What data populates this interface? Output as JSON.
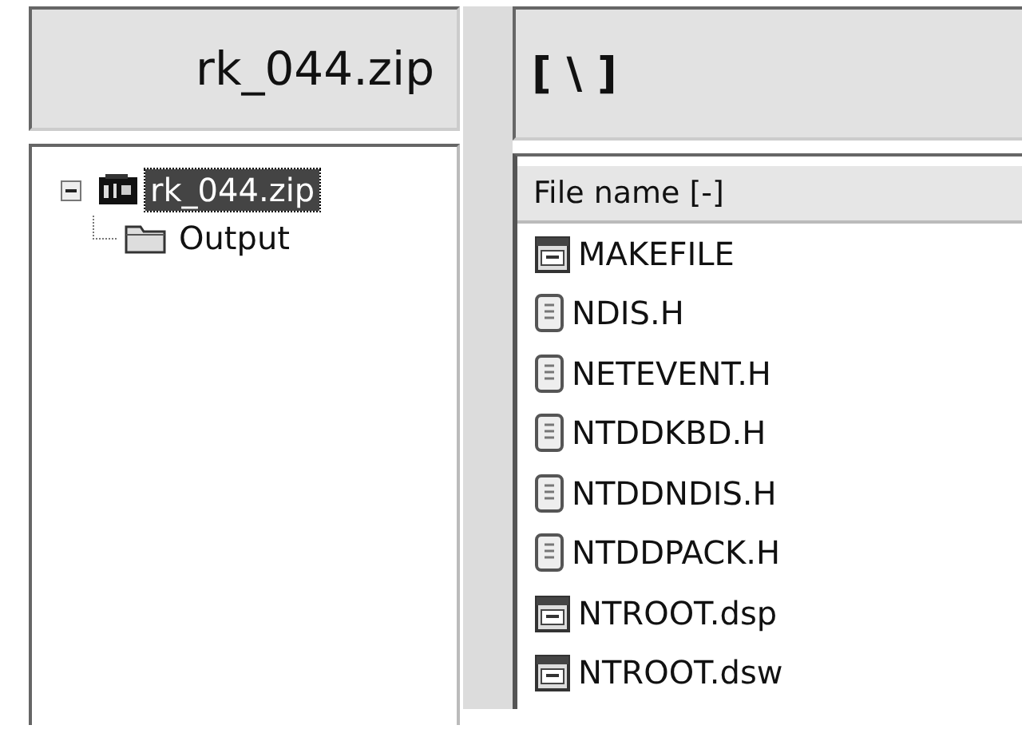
{
  "left_pane": {
    "title": "rk_044.zip",
    "tree": [
      {
        "label": "rk_044.zip",
        "kind": "zip",
        "expanded": true,
        "selected": true,
        "children": [
          {
            "label": "Output",
            "kind": "folder",
            "selected": false
          }
        ]
      }
    ]
  },
  "right_pane": {
    "path": "[ \\ ]",
    "columns": [
      "File name [-]"
    ],
    "files": [
      {
        "name": "MAKEFILE",
        "kind": "project"
      },
      {
        "name": "NDIS.H",
        "kind": "text"
      },
      {
        "name": "NETEVENT.H",
        "kind": "text"
      },
      {
        "name": "NTDDKBD.H",
        "kind": "text"
      },
      {
        "name": "NTDDNDIS.H",
        "kind": "text"
      },
      {
        "name": "NTDDPACK.H",
        "kind": "text"
      },
      {
        "name": "NTROOT.dsp",
        "kind": "project"
      },
      {
        "name": "NTROOT.dsw",
        "kind": "project"
      }
    ]
  }
}
